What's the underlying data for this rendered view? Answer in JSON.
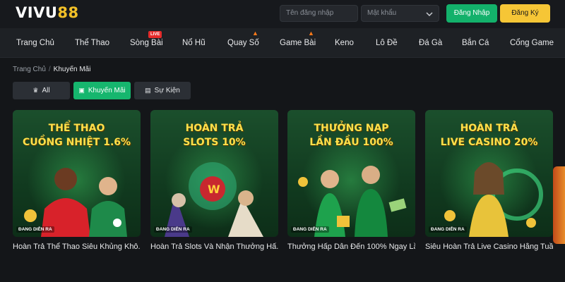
{
  "brand": {
    "part1": "VIVU",
    "part2": "88"
  },
  "header": {
    "username_placeholder": "Tên đăng nhập",
    "password_placeholder": "Mật khẩu",
    "login_label": "Đăng Nhập",
    "register_label": "Đăng Ký"
  },
  "nav": {
    "items": [
      {
        "label": "Trang Chủ"
      },
      {
        "label": "Thể Thao"
      },
      {
        "label": "Sòng Bài",
        "badge": "LIVE"
      },
      {
        "label": "Nổ Hũ"
      },
      {
        "label": "Quay Số",
        "icon": "fire-icon"
      },
      {
        "label": "Game Bài",
        "icon": "fire-icon"
      },
      {
        "label": "Keno"
      },
      {
        "label": "Lô Đề"
      },
      {
        "label": "Đá Gà"
      },
      {
        "label": "Bắn Cá"
      },
      {
        "label": "Cổng Game"
      }
    ]
  },
  "breadcrumb": {
    "home": "Trang Chủ",
    "separator": "/",
    "current": "Khuyến Mãi"
  },
  "tabs": [
    {
      "label": "All",
      "icon": "crown-icon"
    },
    {
      "label": "Khuyến Mãi",
      "icon": "gift-icon",
      "active": true
    },
    {
      "label": "Sự Kiện",
      "icon": "calendar-icon"
    }
  ],
  "cards": [
    {
      "title_line1": "THỂ THAO",
      "title_line2": "CUỒNG NHIỆT 1.6%",
      "tag": "ĐANG DIỄN RA",
      "caption": "Hoàn Trả Thể Thao Siêu Khủng Khô..."
    },
    {
      "title_line1": "HOÀN TRẢ",
      "title_line2": "SLOTS 10%",
      "tag": "ĐANG DIỄN RA",
      "caption": "Hoàn Trả Slots Và Nhận Thưởng Hấ..."
    },
    {
      "title_line1": "THƯỞNG NẠP",
      "title_line2": "LẦN ĐẦU 100%",
      "tag": "ĐANG DIỄN RA",
      "caption": "Thưởng Hấp Dẫn Đến 100% Ngay Lầ..."
    },
    {
      "title_line1": "HOÀN TRẢ",
      "title_line2": "LIVE CASINO 20%",
      "tag": "ĐANG DIỄN RA",
      "caption": "Siêu Hoàn Trả Live Casino Hằng Tuần"
    }
  ],
  "colors": {
    "accent_green": "#16b66e",
    "accent_yellow": "#f6c636",
    "title_yellow": "#ffe04a",
    "live_red": "#e52b2b"
  }
}
